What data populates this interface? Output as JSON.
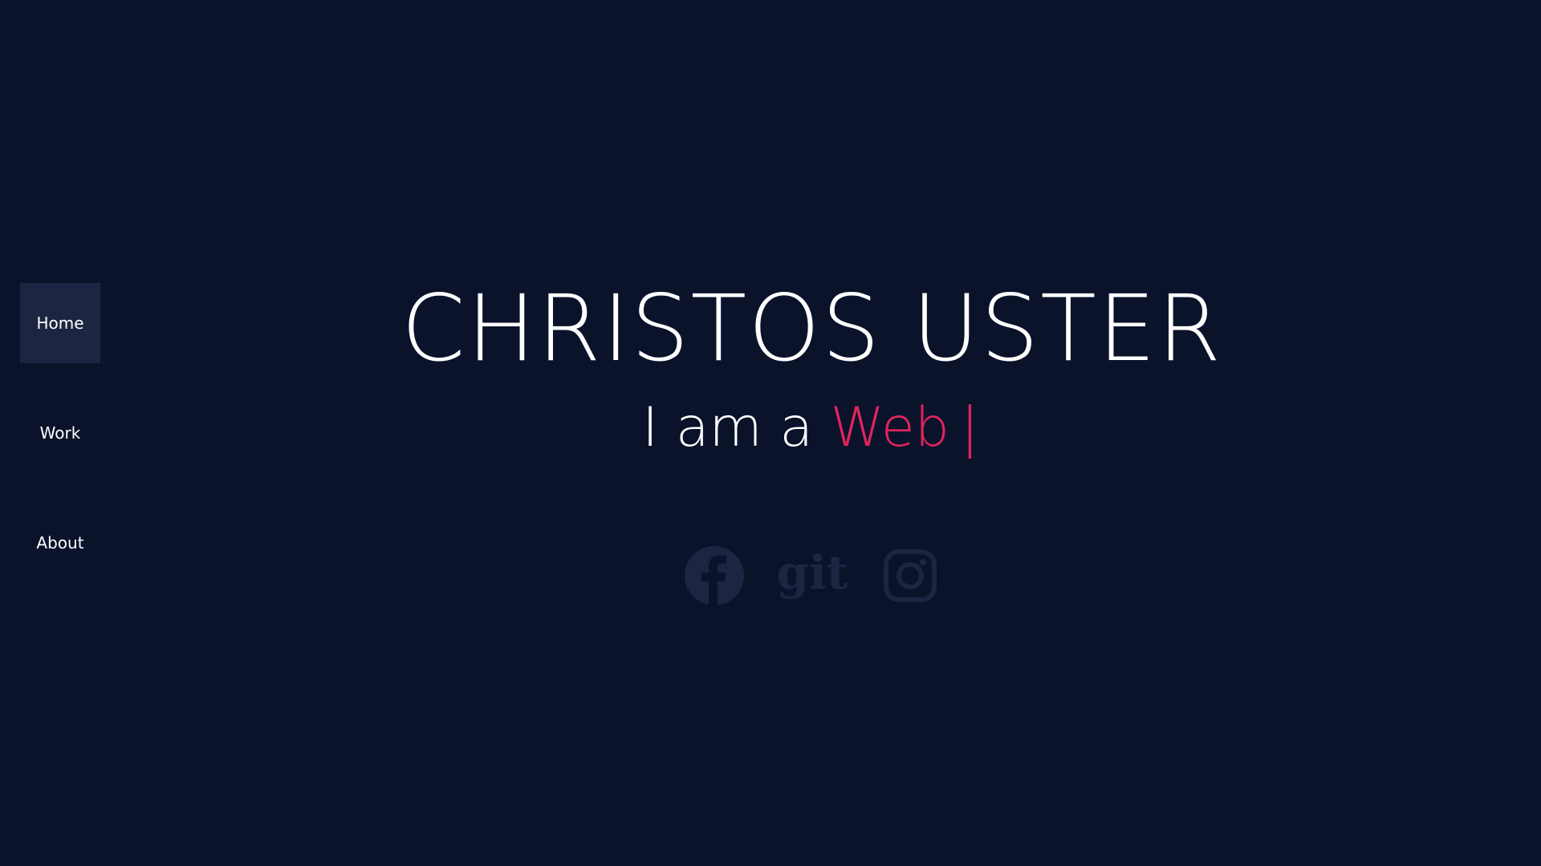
{
  "sidebar": {
    "items": [
      {
        "label": "Home",
        "active": true
      },
      {
        "label": "Work",
        "active": false
      },
      {
        "label": "About",
        "active": false
      }
    ]
  },
  "hero": {
    "name": "CHRISTOS USTER",
    "tagline_lead": "I am a",
    "tagline_role": "Web",
    "tagline_cursor": "|"
  },
  "socials": {
    "items": [
      {
        "icon": "facebook-icon"
      },
      {
        "icon": "git-icon",
        "text": "git"
      },
      {
        "icon": "instagram-icon"
      }
    ]
  },
  "colors": {
    "background": "#0b132b",
    "active_nav": "#1c2541",
    "accent": "#e0245e",
    "icons": "#1c2541",
    "text": "#ffffff"
  }
}
